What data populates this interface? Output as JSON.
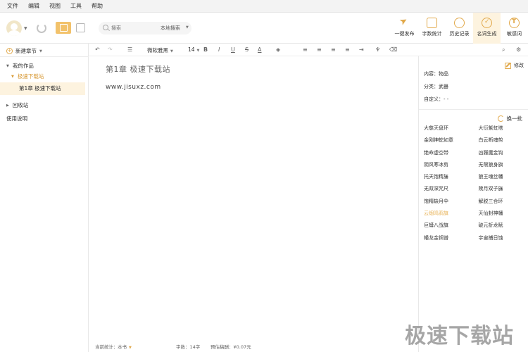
{
  "menubar": {
    "items": [
      "文件",
      "编辑",
      "视图",
      "工具",
      "帮助"
    ]
  },
  "toolbar": {
    "search": {
      "placeholder": "搜索",
      "scope": "本地搜索"
    },
    "actions": [
      {
        "label": "一键发布",
        "icon": "send-icon"
      },
      {
        "label": "字数统计",
        "icon": "word-count-icon"
      },
      {
        "label": "历史记录",
        "icon": "history-icon"
      },
      {
        "label": "名词生成",
        "icon": "name-generator-icon",
        "active": true
      },
      {
        "label": "敏感词",
        "icon": "sensitive-word-icon"
      }
    ]
  },
  "sidebar": {
    "new_chapter": "新建章节",
    "tree": {
      "my_works": "我的作品",
      "book": "极速下载站",
      "chapter": "第1章 极速下载站",
      "recycle": "回收站",
      "help": "使用说明"
    }
  },
  "formatbar": {
    "font": "微软雅黑",
    "size": "14",
    "bold": "B",
    "italic": "I",
    "underline": "U",
    "strike": "S",
    "color": "A"
  },
  "editor": {
    "title": "第1章 极速下载站",
    "content": "www.jisuxz.com"
  },
  "statusbar": {
    "scope_label": "当前统计：",
    "scope_value": "本书",
    "words_label": "字数：",
    "words_value": "14字",
    "income_label": "预估稿酬：",
    "income_value": "¥0.07元"
  },
  "rightpanel": {
    "edit": "修改",
    "content_label": "内容：物品",
    "category_label": "分类：武器",
    "custom_label": "自定义：- -",
    "refresh": "换一批",
    "names": [
      "大慈天盘环",
      "大衍紫虹塔",
      "金刚神蛇如意",
      "白云断魂剪",
      "绝命虚空带",
      "凶履魔金钩",
      "阴风寒冰剪",
      "无限狼身旗",
      "托天饱精旛",
      "狼王魂丝幡",
      "无双深咒尺",
      "赎月双子旛",
      "饱精缺月伞",
      "解脱三合环",
      "云烟鸣鸦旗",
      "天仙封神幡",
      "巨蟒八战旗",
      "破元折龙赋",
      "幡龙金铜谱",
      "宇宙捕日蚀"
    ],
    "highlight_index": 14
  },
  "watermark": "极速下载站",
  "colors": {
    "accent": "#e1a849",
    "active_bg": "#fdf3df"
  }
}
